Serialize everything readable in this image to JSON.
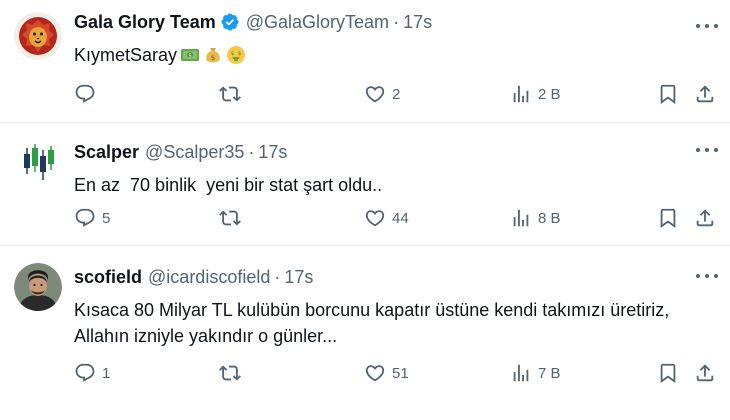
{
  "tweets": [
    {
      "name": "Gala Glory Team",
      "handle": "@GalaGloryTeam",
      "time": "17s",
      "text": "KıymetSaray",
      "emojis": [
        "dollar-banknote",
        "money-bag",
        "money-mouth-face"
      ],
      "verified": true,
      "avatar": "lion-avatar",
      "reply_count": "",
      "retweet_count": "",
      "like_count": "2",
      "view_count": "2 B"
    },
    {
      "name": "Scalper",
      "handle": "@Scalper35",
      "time": "17s",
      "text": "En az  70 binlik  yeni bir stat şart oldu..",
      "verified": false,
      "avatar": "candlestick-avatar",
      "reply_count": "5",
      "retweet_count": "",
      "like_count": "44",
      "view_count": "8 B"
    },
    {
      "name": "scofield",
      "handle": "@icardiscofield",
      "time": "17s",
      "text_lines": [
        "Kısaca 80 Milyar TL kulübün borcunu kapatır üstüne kendi takımızı üretiriz,",
        "Allahın izniyle yakındır o günler..."
      ],
      "verified": false,
      "avatar": "person-avatar",
      "reply_count": "1",
      "retweet_count": "",
      "like_count": "51",
      "view_count": "7 B"
    }
  ],
  "separator": "·",
  "colors": {
    "text": "#0f1419",
    "secondary": "#536471",
    "verified": "#1d9bf0",
    "border": "#e6ecf0"
  }
}
